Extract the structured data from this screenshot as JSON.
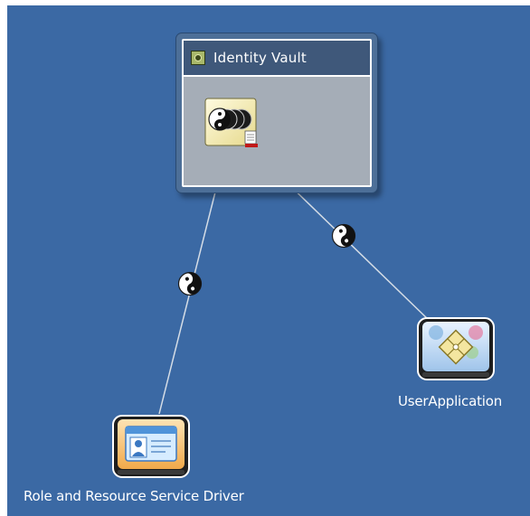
{
  "vault": {
    "title": "Identity Vault",
    "header_icon": "vault-small-icon",
    "body_icon": "yin-yang-server-stack-icon"
  },
  "drivers": [
    {
      "label": "UserApplication",
      "icon": "user-application-icon"
    },
    {
      "label": "Role and Resource Service Driver",
      "icon": "id-badge-icon"
    }
  ],
  "connection_icon": "yin-yang-icon",
  "colors": {
    "canvas": "#3b69a4",
    "vault_frame": "#4d6f98",
    "vault_header": "#3f587a",
    "vault_body": "#a5adb7",
    "link_line": "#d5dde6"
  }
}
